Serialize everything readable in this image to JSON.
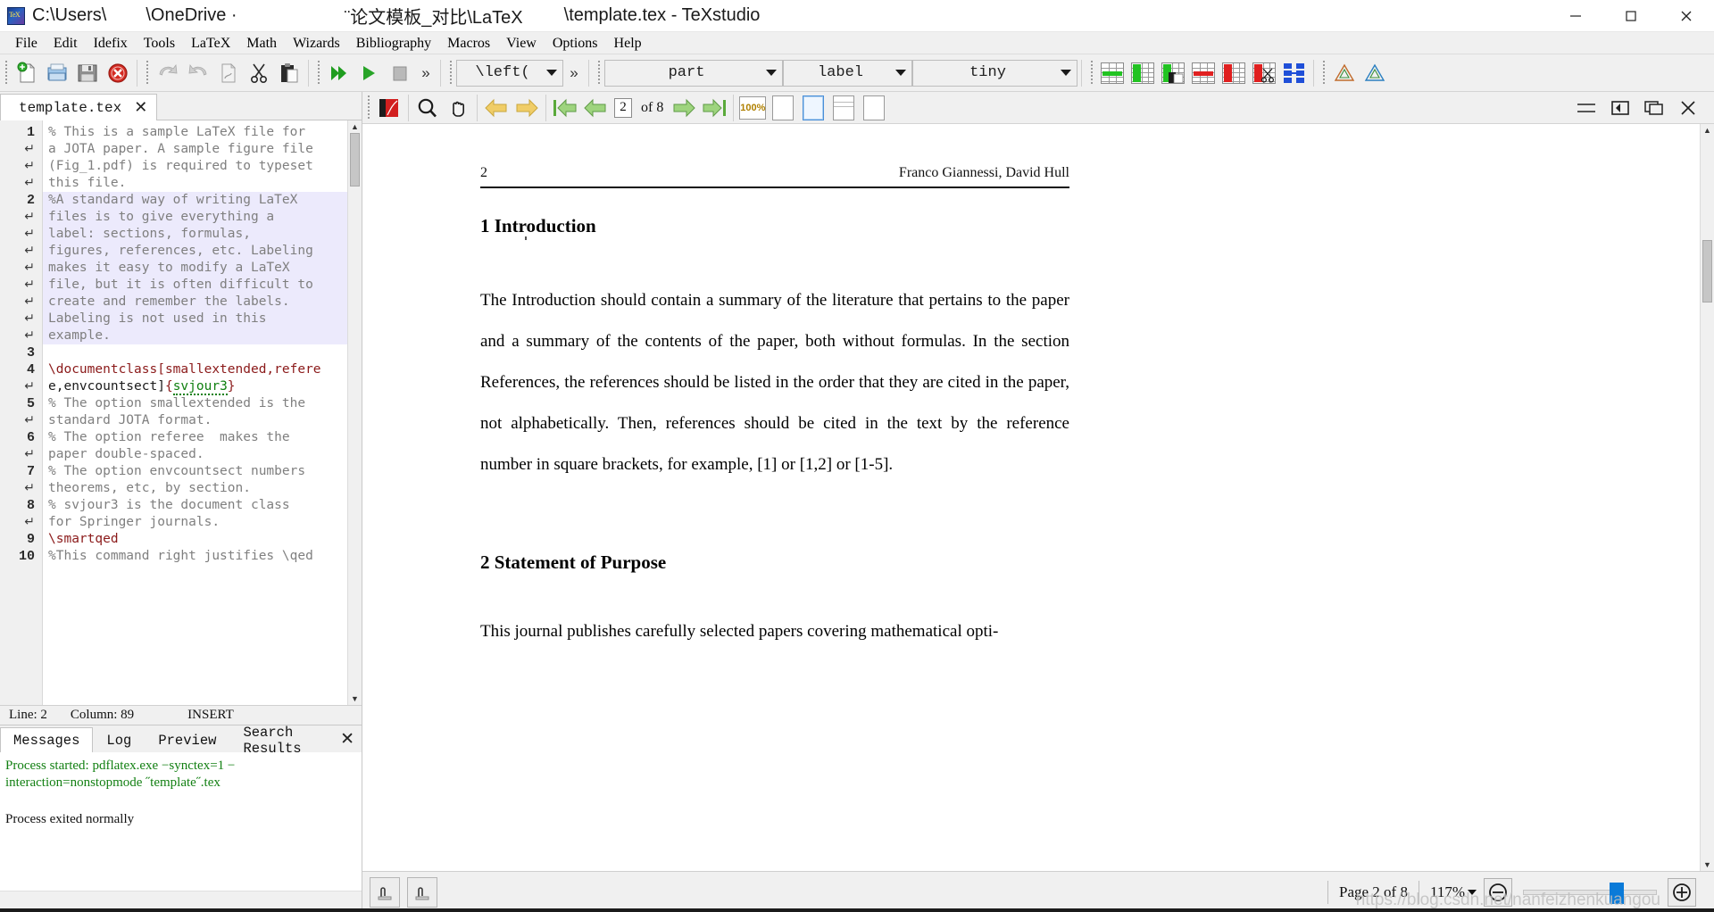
{
  "window": {
    "title_segments": [
      "C:\\Users\\",
      "\\OneDrive ·",
      "¨论文模板_对比\\LaTeX",
      "\\template.tex - TeXstudio"
    ],
    "app_icon": "tex-logo-icon",
    "minimize": "minimize-icon",
    "maximize": "maximize-icon",
    "close": "close-icon"
  },
  "menubar": {
    "items": [
      "File",
      "Edit",
      "Idefix",
      "Tools",
      "LaTeX",
      "Math",
      "Wizards",
      "Bibliography",
      "Macros",
      "View",
      "Options",
      "Help"
    ]
  },
  "toolbar": {
    "file_group": [
      "new-document-icon",
      "open-document-icon",
      "save-document-icon",
      "close-document-icon"
    ],
    "edit_group": [
      "undo-icon",
      "redo-icon",
      "copy-icon",
      "cut-icon",
      "paste-icon"
    ],
    "build_group": [
      "build-and-view-icon",
      "compile-icon",
      "stop-icon"
    ],
    "overflow_label": "»",
    "combo_left": {
      "value": "\\left(",
      "name": "left-delimiter-combo"
    },
    "combo_part": {
      "value": "part",
      "name": "structure-level-combo"
    },
    "combo_label": {
      "value": "label",
      "name": "label-combo"
    },
    "combo_size": {
      "value": "tiny",
      "name": "font-size-combo"
    },
    "table_icons": [
      "add-row-icon",
      "add-column-icon",
      "paste-column-icon",
      "delete-row-icon",
      "delete-column-icon",
      "cut-column-icon",
      "table-structure-icon"
    ],
    "warn_icons": [
      "warning-icon",
      "warning-alt-icon"
    ]
  },
  "editor": {
    "tab": {
      "label": "template.tex",
      "close": "✕"
    },
    "lines": [
      {
        "num": "1",
        "text": "% This is a sample LaTeX file for",
        "style": "comment",
        "hl": false
      },
      {
        "num": "↵",
        "text": "a JOTA paper. A sample figure file",
        "style": "comment",
        "hl": false
      },
      {
        "num": "↵",
        "text": "(Fig_1.pdf) is required to typeset",
        "style": "comment",
        "hl": false
      },
      {
        "num": "↵",
        "text": "this file.",
        "style": "comment",
        "hl": false
      },
      {
        "num": "2",
        "text": "%A standard way of writing LaTeX",
        "style": "comment",
        "hl": true
      },
      {
        "num": "↵",
        "text": "files is to give everything a",
        "style": "comment",
        "hl": true
      },
      {
        "num": "↵",
        "text": "label: sections, formulas,",
        "style": "comment",
        "hl": true
      },
      {
        "num": "↵",
        "text": "figures, references, etc. Labeling",
        "style": "comment",
        "hl": true
      },
      {
        "num": "↵",
        "text": "makes it easy to modify a LaTeX",
        "style": "comment",
        "hl": true
      },
      {
        "num": "↵",
        "text": "file, but it is often difficult to",
        "style": "comment",
        "hl": true
      },
      {
        "num": "↵",
        "text": "create and remember the labels.",
        "style": "comment",
        "hl": true
      },
      {
        "num": "↵",
        "text": "Labeling is not used in this",
        "style": "comment",
        "hl": true
      },
      {
        "num": "↵",
        "text": "example.",
        "style": "comment",
        "hl": true
      },
      {
        "num": "3",
        "text": "",
        "style": "comment",
        "hl": false
      },
      {
        "num": "4",
        "text": "\\documentclass[smallextended,refere",
        "style": "command",
        "hl": false
      },
      {
        "num": "↵",
        "text": "e,envcountsect]{svjour3}",
        "style": "classline",
        "hl": false
      },
      {
        "num": "5",
        "text": "% The option smallextended is the",
        "style": "comment",
        "hl": false
      },
      {
        "num": "↵",
        "text": "standard JOTA format.",
        "style": "comment",
        "hl": false
      },
      {
        "num": "6",
        "text": "% The option referee  makes the",
        "style": "comment",
        "hl": false
      },
      {
        "num": "↵",
        "text": "paper double-spaced.",
        "style": "comment",
        "hl": false
      },
      {
        "num": "7",
        "text": "% The option envcountsect numbers",
        "style": "comment",
        "hl": false
      },
      {
        "num": "↵",
        "text": "theorems, etc, by section.",
        "style": "comment",
        "hl": false
      },
      {
        "num": "8",
        "text": "% svjour3 is the document class",
        "style": "comment",
        "hl": false
      },
      {
        "num": "↵",
        "text": "for Springer journals.",
        "style": "comment",
        "hl": false
      },
      {
        "num": "9",
        "text": "\\smartqed",
        "style": "command",
        "hl": false
      },
      {
        "num": "10",
        "text": "%This command right justifies \\qed",
        "style": "comment",
        "hl": false
      }
    ],
    "status": {
      "line_label": "Line: 2",
      "column_label": "Column: 89",
      "mode": "INSERT"
    }
  },
  "messages": {
    "tabs": [
      "Messages",
      "Log",
      "Preview",
      "Search Results"
    ],
    "active_tab": "Messages",
    "close": "✕",
    "process_started": "Process started: pdflatex.exe −synctex=1 −",
    "process_started_cont": "interaction=nonstopmode ˝template˝.tex",
    "process_exited": "Process exited normally"
  },
  "pdf_toolbar": {
    "buttons": [
      "open-pdf-icon",
      "search-icon",
      "hand-tool-icon",
      "back-arrow-icon",
      "forward-arrow-icon",
      "first-page-icon",
      "previous-page-icon",
      "next-page-icon",
      "last-page-icon"
    ],
    "page_value": "2",
    "page_of": "of  8",
    "zoom_100_label": "100%",
    "fit_buttons": [
      "fit-to-width-icon",
      "fit-to-page-icon",
      "fit-to-text-width-icon",
      "continuous-page-icon"
    ],
    "view_buttons": [
      "toggle-panel-icon",
      "split-view-icon",
      "windowed-view-icon",
      "close-viewer-icon"
    ]
  },
  "pdf_page": {
    "page_number": "2",
    "running_head": "Franco Giannessi, David Hull",
    "section1": "1 Introduction",
    "paragraph1": "The Introduction should contain a summary of the literature that pertains to the paper and a summary of the contents of the paper, both without formulas. In the section References, the references should be listed in the order that they are cited in the paper, not alphabetically. Then, references should be cited in the text by the reference number in square brackets, for example, [1] or [1,2] or [1-5].",
    "section2": "2 Statement of Purpose",
    "paragraph2": "This journal publishes carefully selected papers covering mathematical opti-"
  },
  "pdf_status": {
    "sync_buttons": [
      "sync-to-source-icon",
      "sync-to-pdf-icon"
    ],
    "page_label": "Page  2  of  8",
    "zoom_label": "117%",
    "zoom_out": "zoom-out-icon",
    "zoom_in": "zoom-in-icon",
    "watermark": "https://blog.csdn.net/nanfeizhenkuangou"
  },
  "colors": {
    "accent": "#0a7ad8",
    "green": "#22c322",
    "red": "#e02020",
    "blue": "#1f4fd8",
    "comment": "#7f7f7f",
    "command": "#8b1a1a",
    "selection": "#eceafc",
    "success": "#138013"
  }
}
